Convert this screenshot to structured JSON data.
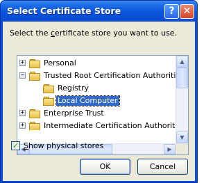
{
  "window": {
    "title": "Select Certificate Store"
  },
  "titlebar": {
    "help_label": "?",
    "close_label": "✕"
  },
  "dialog": {
    "prompt_before": "Select the ",
    "prompt_underlined": "c",
    "prompt_after": "ertificate store you want to use."
  },
  "tree": {
    "items": [
      {
        "label": "Personal",
        "expander": "+"
      },
      {
        "label": "Trusted Root Certification Authorities",
        "expander": "−"
      },
      {
        "label": "Registry"
      },
      {
        "label": "Local Computer",
        "selected": true
      },
      {
        "label": "Enterprise Trust",
        "expander": "+"
      },
      {
        "label": "Intermediate Certification Authorities",
        "expander": "+"
      }
    ],
    "icon": "folder-icon"
  },
  "scrollbar": {
    "up_label": "▲",
    "down_label": "▼",
    "left_label": "◀",
    "right_label": "▶"
  },
  "options": {
    "show_physical_prefix": "S",
    "show_physical_rest": "how physical stores",
    "show_physical_checked": true,
    "check_mark": "✓"
  },
  "buttons": {
    "ok_label": "OK",
    "cancel_label": "Cancel"
  },
  "colors": {
    "titlebar": "#0b55dc",
    "selection": "#316ac5",
    "dialog_bg": "#ece9d8"
  }
}
